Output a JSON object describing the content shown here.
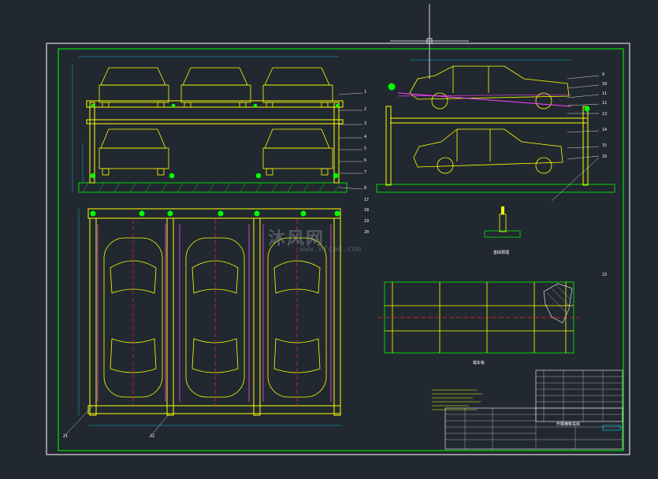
{
  "watermark": {
    "brand": "沐风网",
    "url": "www.mfcad.com"
  },
  "drawing": {
    "title_block": {
      "drawing_name": "升降横移车库"
    },
    "views": {
      "plan_caption": "俯视图",
      "base_caption": "基础预埋",
      "frame_caption": "载车板"
    },
    "balloons": [
      "1",
      "2",
      "3",
      "4",
      "5",
      "6",
      "7",
      "8",
      "9",
      "10",
      "11",
      "12",
      "13",
      "14",
      "15",
      "16",
      "17",
      "18",
      "19",
      "20",
      "21",
      "22",
      "23"
    ]
  },
  "colors": {
    "background": "#212830",
    "frame": "#ffffff",
    "border_green": "#00ff00",
    "structure_yellow": "#ffff00",
    "centerline_red": "#ff2020",
    "hidden_magenta": "#ff40ff",
    "dimension_cyan": "#00e5ff"
  }
}
